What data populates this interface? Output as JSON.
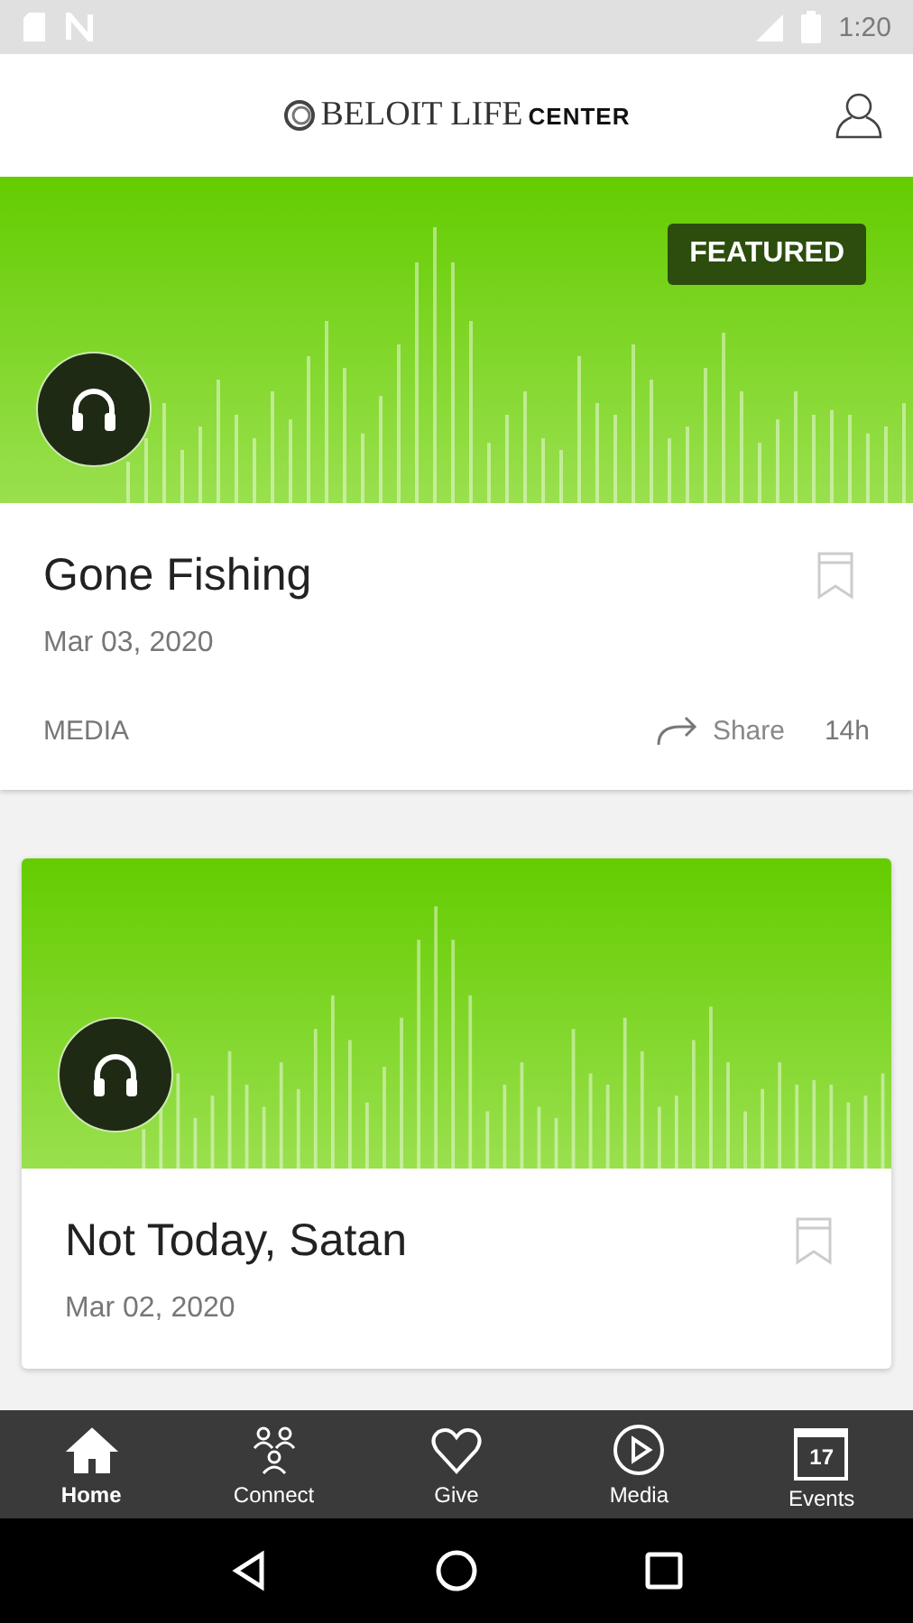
{
  "status_bar": {
    "time": "1:20"
  },
  "header": {
    "logo_main": "BELOIT LIFE",
    "logo_sub": "CENTER"
  },
  "cards": [
    {
      "badge": "FEATURED",
      "title": "Gone Fishing",
      "date": "Mar 03, 2020",
      "category": "MEDIA",
      "share": "Share",
      "age": "14h",
      "full_width": true
    },
    {
      "title": "Not Today, Satan",
      "date": "Mar 02, 2020",
      "full_width": false
    }
  ],
  "tabs": [
    {
      "label": "Home",
      "kind": "home",
      "selected": true
    },
    {
      "label": "Connect",
      "kind": "connect",
      "selected": false
    },
    {
      "label": "Give",
      "kind": "give",
      "selected": false
    },
    {
      "label": "Media",
      "kind": "media",
      "selected": false
    },
    {
      "label": "Events",
      "kind": "events",
      "selected": false,
      "badge": "17"
    }
  ]
}
